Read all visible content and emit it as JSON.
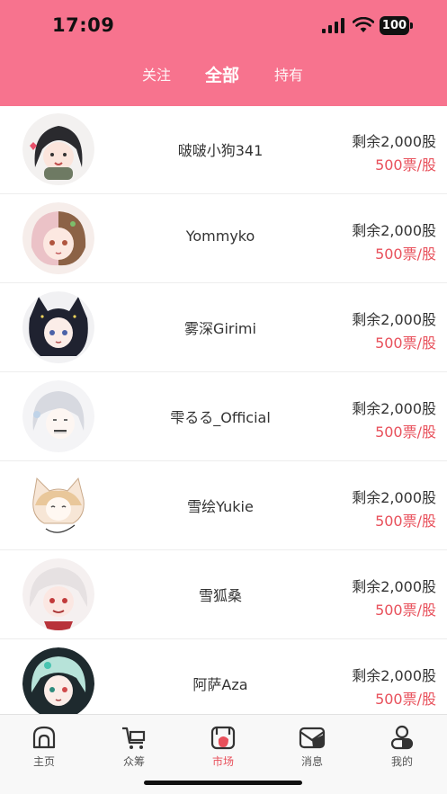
{
  "status_bar": {
    "time": "17:09",
    "battery": "100"
  },
  "tabs": [
    {
      "label": "关注",
      "active": false
    },
    {
      "label": "全部",
      "active": true
    },
    {
      "label": "持有",
      "active": false
    }
  ],
  "list": [
    {
      "name": "啵啵小狗341",
      "remaining": "剩余2,000股",
      "price": "500票/股"
    },
    {
      "name": "Yommyko",
      "remaining": "剩余2,000股",
      "price": "500票/股"
    },
    {
      "name": "雾深Girimi",
      "remaining": "剩余2,000股",
      "price": "500票/股"
    },
    {
      "name": "雫るる_Official",
      "remaining": "剩余2,000股",
      "price": "500票/股"
    },
    {
      "name": "雪绘Yukie",
      "remaining": "剩余2,000股",
      "price": "500票/股"
    },
    {
      "name": "雪狐桑",
      "remaining": "剩余2,000股",
      "price": "500票/股"
    },
    {
      "name": "阿萨Aza",
      "remaining": "剩余2,000股",
      "price": "500票/股"
    }
  ],
  "tabbar": [
    {
      "label": "主页",
      "icon": "home-icon",
      "active": false
    },
    {
      "label": "众筹",
      "icon": "cart-icon",
      "active": false
    },
    {
      "label": "市场",
      "icon": "market-icon",
      "active": true
    },
    {
      "label": "消息",
      "icon": "message-icon",
      "active": false
    },
    {
      "label": "我的",
      "icon": "profile-icon",
      "active": false
    }
  ],
  "colors": {
    "accent": "#F7738E",
    "price": "#E8505B"
  }
}
